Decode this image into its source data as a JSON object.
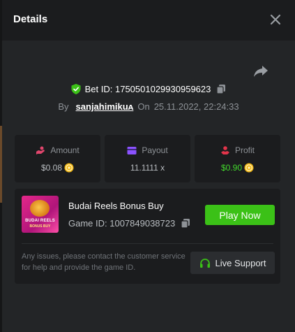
{
  "modal": {
    "title": "Details"
  },
  "bet": {
    "id_text": "Bet ID: 1750501029930959623",
    "by_label": "By",
    "username": "sanjahimikuᴀ",
    "on_label": "On",
    "date": "25.11.2022, 22:24:33"
  },
  "stats": {
    "amount": {
      "label": "Amount",
      "value": "$0.08"
    },
    "payout": {
      "label": "Payout",
      "value": "11.1111 x"
    },
    "profit": {
      "label": "Profit",
      "value": "$0.90"
    }
  },
  "game": {
    "name": "Budai Reels Bonus Buy",
    "id_text": "Game ID: 1007849038723",
    "thumb_line1": "BUDAI REELS",
    "thumb_line2": "BONUS BUY",
    "play_label": "Play Now"
  },
  "support": {
    "message": "Any issues, please contact the customer service for help and provide the game ID.",
    "button_label": "Live Support"
  },
  "icons": {
    "close": "close-icon",
    "share": "share-icon",
    "shield": "shield-check-icon",
    "copy": "copy-icon",
    "amount": "hand-coin-icon",
    "payout": "card-icon",
    "profit": "profit-hand-icon",
    "coin": "coin-icon",
    "headset": "headset-icon"
  },
  "colors": {
    "accent_green": "#3bc117",
    "profit_green": "#42d82c",
    "amount_icon": "#e2466d",
    "payout_icon": "#8b52ff",
    "profit_icon": "#e2344a",
    "coin_gold": "#f2b816"
  }
}
